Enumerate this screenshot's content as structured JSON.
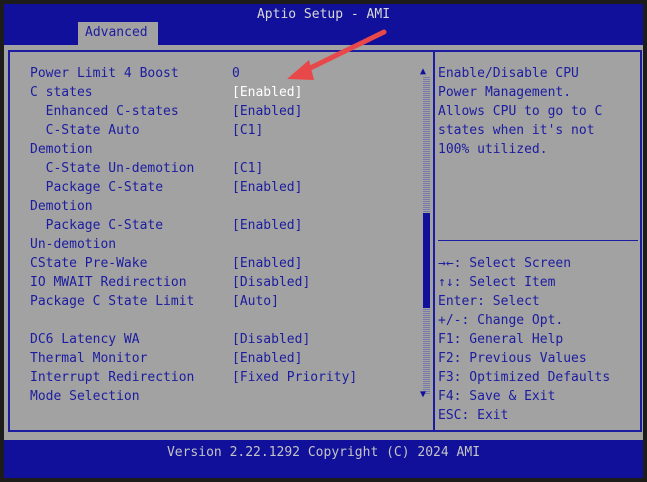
{
  "header": {
    "title": "Aptio Setup - AMI",
    "tab": "Advanced"
  },
  "settings": [
    {
      "label": "Power Limit 4 Boost",
      "value": "0"
    },
    {
      "label": "C states",
      "value": "[Enabled]",
      "selected": true
    },
    {
      "label": "  Enhanced C-states",
      "value": "[Enabled]"
    },
    {
      "label": "  C-State Auto",
      "value": "[C1]"
    },
    {
      "label": "Demotion",
      "value": ""
    },
    {
      "label": "  C-State Un-demotion",
      "value": "[C1]"
    },
    {
      "label": "  Package C-State",
      "value": "[Enabled]"
    },
    {
      "label": "Demotion",
      "value": ""
    },
    {
      "label": "  Package C-State",
      "value": "[Enabled]"
    },
    {
      "label": "Un-demotion",
      "value": ""
    },
    {
      "label": "CState Pre-Wake",
      "value": "[Enabled]"
    },
    {
      "label": "IO MWAIT Redirection",
      "value": "[Disabled]"
    },
    {
      "label": "Package C State Limit",
      "value": "[Auto]"
    },
    {
      "label": "",
      "value": ""
    },
    {
      "label": "DC6 Latency WA",
      "value": "[Disabled]"
    },
    {
      "label": "Thermal Monitor",
      "value": "[Enabled]"
    },
    {
      "label": "Interrupt Redirection",
      "value": "[Fixed Priority]"
    },
    {
      "label": "Mode Selection",
      "value": ""
    }
  ],
  "help": {
    "description": [
      "Enable/Disable CPU",
      "Power Management.",
      "Allows CPU to go to C",
      "states when it's not",
      "100% utilized."
    ],
    "keys": [
      "→←: Select Screen",
      "↑↓: Select Item",
      "Enter: Select",
      "+/-: Change Opt.",
      "F1: General Help",
      "F2: Previous Values",
      "F3: Optimized Defaults",
      "F4: Save & Exit",
      "ESC: Exit"
    ]
  },
  "scroll": {
    "position_fraction": 0.43,
    "visible_fraction": 0.3
  },
  "footer": {
    "version": "Version 2.22.1292 Copyright (C) 2024 AMI"
  },
  "colors": {
    "blue": "#10109a",
    "gray": "#a2a2a2",
    "annotation": "#e8484a"
  }
}
